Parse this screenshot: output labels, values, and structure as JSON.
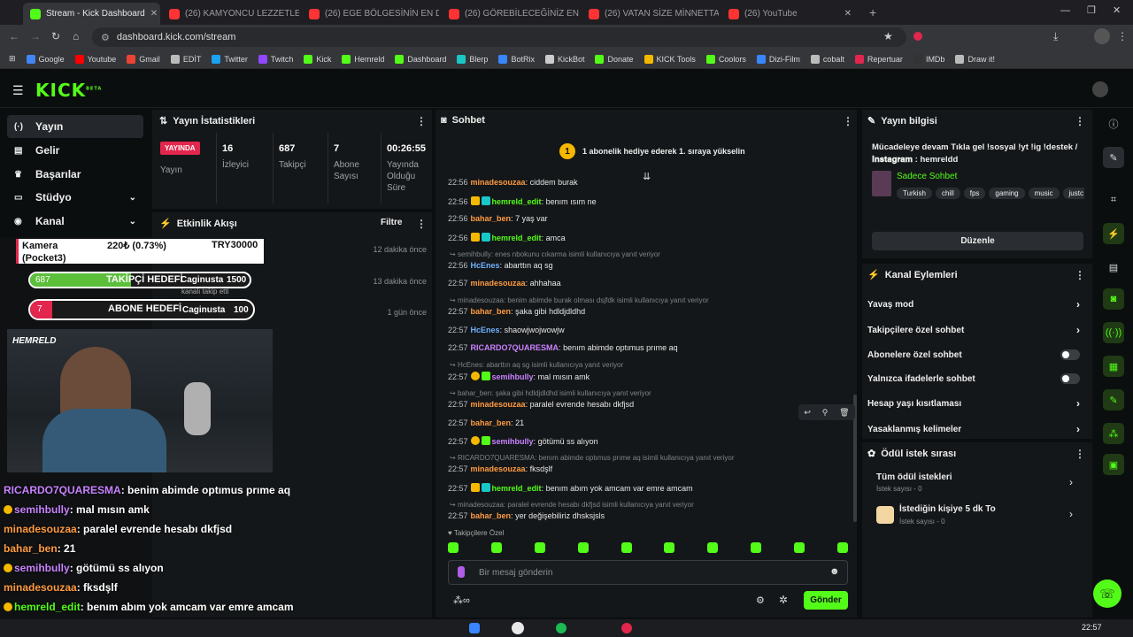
{
  "browser": {
    "tabs": [
      {
        "title": "Stream - Kick Dashboard",
        "active": true,
        "color": "#53fc18"
      },
      {
        "title": "(26) KAMYONCU LEZZETLERİ",
        "color": "#ff3333"
      },
      {
        "title": "(26) EGE BÖLGESİNİN EN DÜŞ",
        "color": "#ff3333"
      },
      {
        "title": "(26) GÖREBİLECEĞİNİZ EN ŞEY",
        "color": "#ff3333"
      },
      {
        "title": "(26) VATAN SİZE MİNNETTAR",
        "color": "#ff3333"
      },
      {
        "title": "(26) YouTube",
        "color": "#ff3333"
      }
    ],
    "url": "dashboard.kick.com/stream",
    "bookmarks": [
      "Google",
      "Youtube",
      "Gmail",
      "EDİT",
      "Twitter",
      "Twitch",
      "Kick",
      "Hemreld",
      "Dashboard",
      "Blerp",
      "BotRix",
      "KickBot",
      "Donate",
      "KICK Tools",
      "Coolors",
      "Dizi-Film",
      "cobalt",
      "Repertuar",
      "IMDb",
      "Draw it!"
    ]
  },
  "logo": "KICK",
  "logo_beta": "BETA",
  "nav": [
    {
      "label": "Yayın",
      "icon": "(·)"
    },
    {
      "label": "Gelir",
      "icon": "▤"
    },
    {
      "label": "Başarılar",
      "icon": "♛"
    },
    {
      "label": "Stüdyo",
      "icon": "▭"
    },
    {
      "label": "Kanal",
      "icon": "◉"
    }
  ],
  "stats": {
    "title": "Yayın İstatistikleri",
    "live_badge": "YAYINDA",
    "live_label": "Yayın",
    "items": [
      {
        "value": "16",
        "label": "İzleyici"
      },
      {
        "value": "687",
        "label": "Takipçi"
      },
      {
        "value": "7",
        "label": "Abone Sayısı"
      },
      {
        "value": "00:26:55",
        "label": "Yayında Olduğu Süre"
      }
    ]
  },
  "events": {
    "title": "Etkinlik Akışı",
    "filter": "Filtre",
    "times": [
      "12 dakika önce",
      "13 dakika önce",
      "1 gün önce"
    ]
  },
  "overlay": {
    "donation": {
      "label": "Kamera (Pocket3)",
      "amount": "220₺ (0.73%)",
      "goal": "TRY30000"
    },
    "follower_goal": {
      "count": "687",
      "label": "TAKİPÇİ HEDEFİ",
      "name": "Caginusta",
      "target": "1500",
      "progress": 0.458
    },
    "sub_goal": {
      "count": "7",
      "label": "ABONE HEDEFİ",
      "name": "Caginusta",
      "target": "100",
      "progress": 0.07
    },
    "event_note": "kanalı takip etti",
    "cam_tag": "HEMRELD",
    "chat": [
      {
        "user": "RICARDO7QUARESMA",
        "text": "benim abimde optımus prıme aq",
        "color": "#c882ff"
      },
      {
        "user": "semihbully",
        "text": "mal mısın amk",
        "color": "#c882ff",
        "badges": true
      },
      {
        "user": "minadesouzaa",
        "text": "paralel evrende hesabı dkfjsd",
        "color": "#ff9b40"
      },
      {
        "user": "bahar_ben",
        "text": "21",
        "color": "#ff9b40"
      },
      {
        "user": "semihbully",
        "text": "götümü ss alıyon",
        "color": "#c882ff",
        "badges": true
      },
      {
        "user": "minadesouzaa",
        "text": "fksdşlf",
        "color": "#ff9b40"
      },
      {
        "user": "hemreld_edit",
        "text": "benım abım yok amcam var emre amcam",
        "color": "#53fc18",
        "badges": true
      },
      {
        "user": "bahar_ben",
        "text": "yer değişebiliriz dhsksjsls",
        "color": "#ff9b40"
      }
    ]
  },
  "chat": {
    "title": "Sohbet",
    "pinned": "1 abonelik hediye ederek 1. sıraya yükselin",
    "pinned_rank": "1",
    "messages": [
      {
        "time": "22:56",
        "user": "minadesouzaa",
        "text": "ciddem burak",
        "color": "#ff9b40"
      },
      {
        "time": "22:56",
        "user": "hemreld_edit",
        "text": "benım ısım ne",
        "color": "#53fc18",
        "badges": "crown"
      },
      {
        "time": "22:56",
        "user": "bahar_ben",
        "text": "7 yaş var",
        "color": "#ff9b40"
      },
      {
        "time": "22:56",
        "user": "hemreld_edit",
        "text": "amca",
        "color": "#53fc18",
        "badges": "crown"
      },
      {
        "reply": "semihbully: enes nbokunu cıkarma isimli kullanıcıya yanıt veriyor"
      },
      {
        "time": "22:56",
        "user": "HcEnes",
        "text": "abarttın aq sg",
        "color": "#6fb1ff"
      },
      {
        "time": "22:57",
        "user": "minadesouzaa",
        "text": "ahhahaa",
        "color": "#ff9b40"
      },
      {
        "reply": "minadesouzaa: benim abimde burak olması dsjfdk isimli kullanıcıya yanıt veriyor"
      },
      {
        "time": "22:57",
        "user": "bahar_ben",
        "text": "şaka gibi hdldjdldhd",
        "color": "#ff9b40"
      },
      {
        "time": "22:57",
        "user": "HcEnes",
        "text": "shaowjwojwowjw",
        "color": "#6fb1ff"
      },
      {
        "time": "22:57",
        "user": "RICARDO7QUARESMA",
        "text": "benım abimde optımus prıme aq",
        "color": "#c882ff"
      },
      {
        "reply": "HcEnes: abarttın aq sg isimli kullanıcıya yanıt veriyor"
      },
      {
        "time": "22:57",
        "user": "semihbully",
        "text": "mal mısın amk",
        "color": "#c882ff",
        "badges": "sub"
      },
      {
        "reply": "bahar_ben: şaka gibi hdldjdldhd isimli kullanıcıya yanıt veriyor"
      },
      {
        "time": "22:57",
        "user": "minadesouzaa",
        "text": "paralel evrende hesabı dkfjsd",
        "color": "#ff9b40"
      },
      {
        "time": "22:57",
        "user": "bahar_ben",
        "text": "21",
        "color": "#ff9b40"
      },
      {
        "time": "22:57",
        "user": "semihbully",
        "text": "götümü ss alıyon",
        "color": "#c882ff",
        "badges": "sub"
      },
      {
        "reply": "RICARDO7QUARESMA: benım abimde optımus prıme aq isimli kullanıcıya yanıt veriyor"
      },
      {
        "time": "22:57",
        "user": "minadesouzaa",
        "text": "fksdşlf",
        "color": "#ff9b40"
      },
      {
        "time": "22:57",
        "user": "hemreld_edit",
        "text": "benım abım yok amcam var emre amcam",
        "color": "#53fc18",
        "badges": "crown"
      },
      {
        "reply": "minadesouzaa: paralel evrende hesabı dkfjsd isimli kullanıcıya yanıt veriyor"
      },
      {
        "time": "22:57",
        "user": "bahar_ben",
        "text": "yer değişebiliriz dhsksjsls",
        "color": "#ff9b40"
      }
    ],
    "followers_only": "Takipçilere Özel",
    "input_placeholder": "Bir mesaj gönderin",
    "send": "Gönder"
  },
  "stream_info": {
    "title": "Yayın bilgisi",
    "stream_title": "Mücadeleye devam Tıkla gel !sosyal !yt !ig !destek / 𝐈𝐧𝐬𝐭𝐚𝐠𝐫𝐚𝐦 : hemreldd",
    "category": "Sadece Sohbet",
    "tags": [
      "Turkish",
      "chill",
      "fps",
      "gaming",
      "music",
      "justc"
    ],
    "edit": "Düzenle"
  },
  "channel_actions": {
    "title": "Kanal Eylemleri",
    "items": [
      {
        "label": "Yavaş mod",
        "type": "chevron"
      },
      {
        "label": "Takipçilere özel sohbet",
        "type": "chevron"
      },
      {
        "label": "Abonelere özel sohbet",
        "type": "toggle"
      },
      {
        "label": "Yalnızca ifadelerle sohbet",
        "type": "toggle"
      },
      {
        "label": "Hesap yaşı kısıtlaması",
        "type": "chevron"
      },
      {
        "label": "Yasaklanmış kelimeler",
        "type": "chevron"
      }
    ]
  },
  "rewards": {
    "title": "Ödül istek sırası",
    "items": [
      {
        "label": "Tüm ödül istekleri",
        "sub": "İstek sayısı - 0"
      },
      {
        "label": "İstediğin kişiye 5 dk To",
        "sub": "İstek sayısı - 0"
      }
    ]
  },
  "clock": "22:57",
  "colors": {
    "accent": "#53fc18",
    "live": "#e2264d"
  }
}
